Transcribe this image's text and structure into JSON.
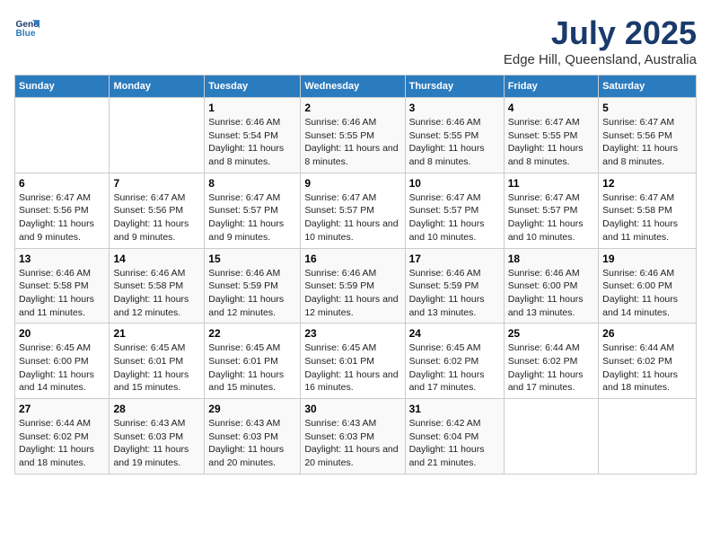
{
  "header": {
    "logo_line1": "General",
    "logo_line2": "Blue",
    "title": "July 2025",
    "subtitle": "Edge Hill, Queensland, Australia"
  },
  "days_of_week": [
    "Sunday",
    "Monday",
    "Tuesday",
    "Wednesday",
    "Thursday",
    "Friday",
    "Saturday"
  ],
  "weeks": [
    [
      {
        "day": "",
        "info": ""
      },
      {
        "day": "",
        "info": ""
      },
      {
        "day": "1",
        "info": "Sunrise: 6:46 AM\nSunset: 5:54 PM\nDaylight: 11 hours and 8 minutes."
      },
      {
        "day": "2",
        "info": "Sunrise: 6:46 AM\nSunset: 5:55 PM\nDaylight: 11 hours and 8 minutes."
      },
      {
        "day": "3",
        "info": "Sunrise: 6:46 AM\nSunset: 5:55 PM\nDaylight: 11 hours and 8 minutes."
      },
      {
        "day": "4",
        "info": "Sunrise: 6:47 AM\nSunset: 5:55 PM\nDaylight: 11 hours and 8 minutes."
      },
      {
        "day": "5",
        "info": "Sunrise: 6:47 AM\nSunset: 5:56 PM\nDaylight: 11 hours and 8 minutes."
      }
    ],
    [
      {
        "day": "6",
        "info": "Sunrise: 6:47 AM\nSunset: 5:56 PM\nDaylight: 11 hours and 9 minutes."
      },
      {
        "day": "7",
        "info": "Sunrise: 6:47 AM\nSunset: 5:56 PM\nDaylight: 11 hours and 9 minutes."
      },
      {
        "day": "8",
        "info": "Sunrise: 6:47 AM\nSunset: 5:57 PM\nDaylight: 11 hours and 9 minutes."
      },
      {
        "day": "9",
        "info": "Sunrise: 6:47 AM\nSunset: 5:57 PM\nDaylight: 11 hours and 10 minutes."
      },
      {
        "day": "10",
        "info": "Sunrise: 6:47 AM\nSunset: 5:57 PM\nDaylight: 11 hours and 10 minutes."
      },
      {
        "day": "11",
        "info": "Sunrise: 6:47 AM\nSunset: 5:57 PM\nDaylight: 11 hours and 10 minutes."
      },
      {
        "day": "12",
        "info": "Sunrise: 6:47 AM\nSunset: 5:58 PM\nDaylight: 11 hours and 11 minutes."
      }
    ],
    [
      {
        "day": "13",
        "info": "Sunrise: 6:46 AM\nSunset: 5:58 PM\nDaylight: 11 hours and 11 minutes."
      },
      {
        "day": "14",
        "info": "Sunrise: 6:46 AM\nSunset: 5:58 PM\nDaylight: 11 hours and 12 minutes."
      },
      {
        "day": "15",
        "info": "Sunrise: 6:46 AM\nSunset: 5:59 PM\nDaylight: 11 hours and 12 minutes."
      },
      {
        "day": "16",
        "info": "Sunrise: 6:46 AM\nSunset: 5:59 PM\nDaylight: 11 hours and 12 minutes."
      },
      {
        "day": "17",
        "info": "Sunrise: 6:46 AM\nSunset: 5:59 PM\nDaylight: 11 hours and 13 minutes."
      },
      {
        "day": "18",
        "info": "Sunrise: 6:46 AM\nSunset: 6:00 PM\nDaylight: 11 hours and 13 minutes."
      },
      {
        "day": "19",
        "info": "Sunrise: 6:46 AM\nSunset: 6:00 PM\nDaylight: 11 hours and 14 minutes."
      }
    ],
    [
      {
        "day": "20",
        "info": "Sunrise: 6:45 AM\nSunset: 6:00 PM\nDaylight: 11 hours and 14 minutes."
      },
      {
        "day": "21",
        "info": "Sunrise: 6:45 AM\nSunset: 6:01 PM\nDaylight: 11 hours and 15 minutes."
      },
      {
        "day": "22",
        "info": "Sunrise: 6:45 AM\nSunset: 6:01 PM\nDaylight: 11 hours and 15 minutes."
      },
      {
        "day": "23",
        "info": "Sunrise: 6:45 AM\nSunset: 6:01 PM\nDaylight: 11 hours and 16 minutes."
      },
      {
        "day": "24",
        "info": "Sunrise: 6:45 AM\nSunset: 6:02 PM\nDaylight: 11 hours and 17 minutes."
      },
      {
        "day": "25",
        "info": "Sunrise: 6:44 AM\nSunset: 6:02 PM\nDaylight: 11 hours and 17 minutes."
      },
      {
        "day": "26",
        "info": "Sunrise: 6:44 AM\nSunset: 6:02 PM\nDaylight: 11 hours and 18 minutes."
      }
    ],
    [
      {
        "day": "27",
        "info": "Sunrise: 6:44 AM\nSunset: 6:02 PM\nDaylight: 11 hours and 18 minutes."
      },
      {
        "day": "28",
        "info": "Sunrise: 6:43 AM\nSunset: 6:03 PM\nDaylight: 11 hours and 19 minutes."
      },
      {
        "day": "29",
        "info": "Sunrise: 6:43 AM\nSunset: 6:03 PM\nDaylight: 11 hours and 20 minutes."
      },
      {
        "day": "30",
        "info": "Sunrise: 6:43 AM\nSunset: 6:03 PM\nDaylight: 11 hours and 20 minutes."
      },
      {
        "day": "31",
        "info": "Sunrise: 6:42 AM\nSunset: 6:04 PM\nDaylight: 11 hours and 21 minutes."
      },
      {
        "day": "",
        "info": ""
      },
      {
        "day": "",
        "info": ""
      }
    ]
  ]
}
